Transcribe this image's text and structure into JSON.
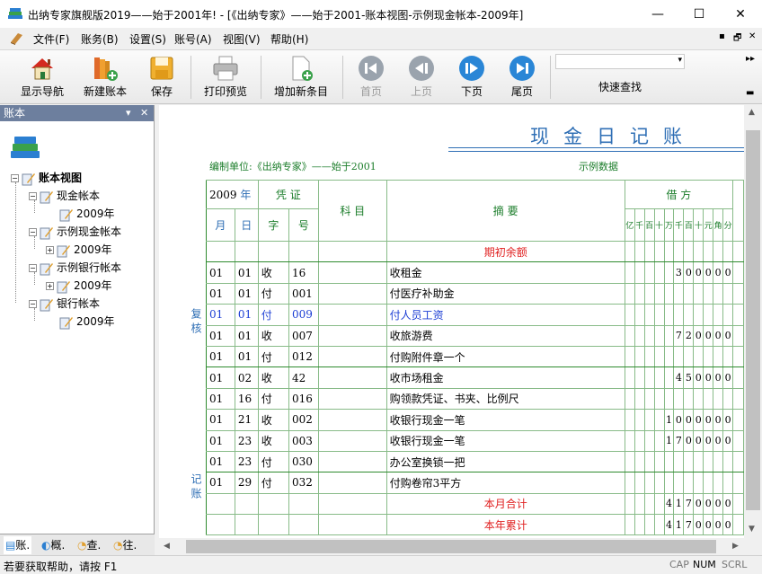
{
  "window": {
    "title": "出纳专家旗舰版2019——始于2001年! - [《出纳专家》——始于2001-账本视图-示例现金帐本-2009年]",
    "minimize": "—",
    "maximize": "☐",
    "close": "✕"
  },
  "menubar": {
    "items": [
      "文件(F)",
      "账务(B)",
      "设置(S)",
      "账号(A)",
      "视图(V)",
      "帮助(H)"
    ],
    "mdi_minimize": "▪",
    "mdi_restore": "🗗",
    "mdi_close": "✕"
  },
  "toolbar": {
    "buttons": [
      {
        "label": "显示导航",
        "icon": "home-icon",
        "enabled": true
      },
      {
        "label": "新建账本",
        "icon": "new-book-icon",
        "enabled": true
      },
      {
        "label": "保存",
        "icon": "save-icon",
        "enabled": true
      },
      {
        "label": "打印预览",
        "icon": "printer-icon",
        "enabled": true
      },
      {
        "label": "增加新条目",
        "icon": "add-document-icon",
        "enabled": true
      },
      {
        "label": "首页",
        "icon": "first-page-icon",
        "enabled": false
      },
      {
        "label": "上页",
        "icon": "prev-page-icon",
        "enabled": false
      },
      {
        "label": "下页",
        "icon": "next-page-icon",
        "enabled": true
      },
      {
        "label": "尾页",
        "icon": "last-page-icon",
        "enabled": true
      }
    ],
    "quick_search_label": "快速查找"
  },
  "left_pane": {
    "header": "账本",
    "pin": "▾",
    "close": "✕",
    "tree": [
      {
        "label": "账本视图",
        "level": 0,
        "expander": "−",
        "bold": true
      },
      {
        "label": "现金帐本",
        "level": 1,
        "expander": "−"
      },
      {
        "label": "2009年",
        "level": 2,
        "expander": ""
      },
      {
        "label": "示例现金帐本",
        "level": 1,
        "expander": "−"
      },
      {
        "label": "2009年",
        "level": 2,
        "expander": "+"
      },
      {
        "label": "示例银行帐本",
        "level": 1,
        "expander": "−"
      },
      {
        "label": "2009年",
        "level": 2,
        "expander": "+"
      },
      {
        "label": "银行帐本",
        "level": 1,
        "expander": "−"
      },
      {
        "label": "2009年",
        "level": 2,
        "expander": ""
      }
    ],
    "tabs": [
      "账.",
      "概.",
      "查.",
      "往."
    ]
  },
  "ledger": {
    "title": "现金日记账",
    "unit_label": "编制单位:《出纳专家》——始于2001",
    "sample_label": "示例数据",
    "side_review": "复核",
    "side_record": "记账",
    "header": {
      "year": "2009",
      "year_suffix": "年",
      "voucher": "凭 证",
      "subject": "科 目",
      "summary": "摘          要",
      "debit": "借 方",
      "month": "月",
      "day": "日",
      "zi": "字",
      "hao": "号",
      "digits": [
        "亿",
        "千",
        "百",
        "十",
        "万",
        "千",
        "百",
        "十",
        "元",
        "角",
        "分"
      ]
    },
    "opening_label": "期初余额",
    "rows": [
      {
        "m": "01",
        "d": "01",
        "zi": "收",
        "hao": "16",
        "summary": "收租金",
        "amount": "300000",
        "blue": false
      },
      {
        "m": "01",
        "d": "01",
        "zi": "付",
        "hao": "001",
        "summary": "付医疗补助金",
        "amount": "",
        "blue": false
      },
      {
        "m": "01",
        "d": "01",
        "zi": "付",
        "hao": "009",
        "summary": "付人员工资",
        "amount": "",
        "blue": true
      },
      {
        "m": "01",
        "d": "01",
        "zi": "收",
        "hao": "007",
        "summary": "收旅游费",
        "amount": "720000",
        "blue": false
      },
      {
        "m": "01",
        "d": "01",
        "zi": "付",
        "hao": "012",
        "summary": "付购附件章一个",
        "amount": "",
        "blue": false
      },
      {
        "m": "01",
        "d": "02",
        "zi": "收",
        "hao": "42",
        "summary": "收市场租金",
        "amount": "450000",
        "blue": false
      },
      {
        "m": "01",
        "d": "16",
        "zi": "付",
        "hao": "016",
        "summary": "购领款凭证、书夹、比例尺",
        "amount": "",
        "blue": false
      },
      {
        "m": "01",
        "d": "21",
        "zi": "收",
        "hao": "002",
        "summary": "收银行现金一笔",
        "amount": "1000000",
        "blue": false
      },
      {
        "m": "01",
        "d": "23",
        "zi": "收",
        "hao": "003",
        "summary": "收银行现金一笔",
        "amount": "1700000",
        "blue": false
      },
      {
        "m": "01",
        "d": "23",
        "zi": "付",
        "hao": "030",
        "summary": "办公室换锁一把",
        "amount": "",
        "blue": false
      },
      {
        "m": "01",
        "d": "29",
        "zi": "付",
        "hao": "032",
        "summary": "付购卷帘3平方",
        "amount": "",
        "blue": false
      }
    ],
    "month_total_label": "本月合计",
    "month_total": "4170000",
    "year_total_label": "本年累计",
    "year_total": "4170000"
  },
  "statusbar": {
    "message": "若要获取帮助，请按 F1",
    "cap": "CAP",
    "num": "NUM",
    "scrl": "SCRL"
  }
}
